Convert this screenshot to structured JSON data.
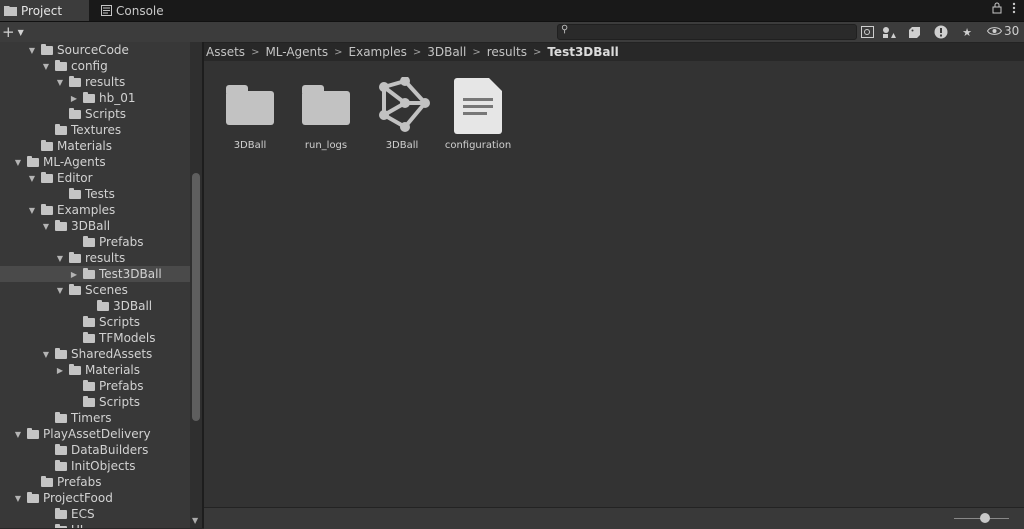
{
  "tabs": [
    {
      "label": "Project",
      "icon": "folder-icon",
      "active": true
    },
    {
      "label": "Console",
      "icon": "console-icon",
      "active": false
    }
  ],
  "toolbar": {
    "create_label": "+",
    "search_placeholder": "",
    "hidden_packages_count": "30"
  },
  "tree": [
    {
      "label": "SourceCode",
      "depth": 2,
      "expanded": true,
      "arrow": true
    },
    {
      "label": "config",
      "depth": 3,
      "expanded": true,
      "arrow": true
    },
    {
      "label": "results",
      "depth": 4,
      "expanded": true,
      "arrow": true
    },
    {
      "label": "hb_01",
      "depth": 5,
      "expanded": false,
      "arrow": true
    },
    {
      "label": "Scripts",
      "depth": 4,
      "arrow": false
    },
    {
      "label": "Textures",
      "depth": 3,
      "arrow": false
    },
    {
      "label": "Materials",
      "depth": 2,
      "arrow": false
    },
    {
      "label": "ML-Agents",
      "depth": 1,
      "expanded": true,
      "arrow": true
    },
    {
      "label": "Editor",
      "depth": 2,
      "expanded": true,
      "arrow": true
    },
    {
      "label": "Tests",
      "depth": 4,
      "arrow": false
    },
    {
      "label": "Examples",
      "depth": 2,
      "expanded": true,
      "arrow": true
    },
    {
      "label": "3DBall",
      "depth": 3,
      "expanded": true,
      "arrow": true
    },
    {
      "label": "Prefabs",
      "depth": 5,
      "arrow": false
    },
    {
      "label": "results",
      "depth": 4,
      "expanded": true,
      "arrow": true
    },
    {
      "label": "Test3DBall",
      "depth": 5,
      "expanded": false,
      "arrow": true,
      "selected": true
    },
    {
      "label": "Scenes",
      "depth": 4,
      "expanded": true,
      "arrow": true
    },
    {
      "label": "3DBall",
      "depth": 6,
      "arrow": false
    },
    {
      "label": "Scripts",
      "depth": 5,
      "arrow": false
    },
    {
      "label": "TFModels",
      "depth": 5,
      "arrow": false
    },
    {
      "label": "SharedAssets",
      "depth": 3,
      "expanded": true,
      "arrow": true
    },
    {
      "label": "Materials",
      "depth": 4,
      "expanded": false,
      "arrow": true
    },
    {
      "label": "Prefabs",
      "depth": 5,
      "arrow": false
    },
    {
      "label": "Scripts",
      "depth": 5,
      "arrow": false
    },
    {
      "label": "Timers",
      "depth": 3,
      "arrow": false
    },
    {
      "label": "PlayAssetDelivery",
      "depth": 1,
      "expanded": true,
      "arrow": true
    },
    {
      "label": "DataBuilders",
      "depth": 3,
      "arrow": false
    },
    {
      "label": "InitObjects",
      "depth": 3,
      "arrow": false
    },
    {
      "label": "Prefabs",
      "depth": 2,
      "arrow": false
    },
    {
      "label": "ProjectFood",
      "depth": 1,
      "expanded": true,
      "arrow": true
    },
    {
      "label": "ECS",
      "depth": 3,
      "arrow": false
    },
    {
      "label": "UI",
      "depth": 3,
      "arrow": false
    }
  ],
  "breadcrumb": [
    "Assets",
    "ML-Agents",
    "Examples",
    "3DBall",
    "results",
    "Test3DBall"
  ],
  "assets": [
    {
      "label": "3DBall",
      "kind": "folder",
      "icon": "folder-icon"
    },
    {
      "label": "run_logs",
      "kind": "folder",
      "icon": "folder-icon"
    },
    {
      "label": "3DBall",
      "kind": "model",
      "icon": "neural-network-icon"
    },
    {
      "label": "configuration",
      "kind": "document",
      "icon": "document-icon"
    }
  ],
  "colors": {
    "selection": "#4a4a4a",
    "panel": "#383838",
    "asset_area": "#333333"
  }
}
